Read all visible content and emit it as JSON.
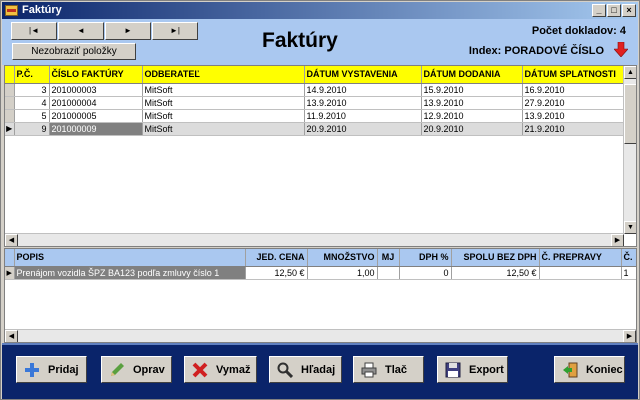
{
  "window": {
    "title": "Faktúry"
  },
  "titlebar_buttons": [
    "_",
    "□",
    "×"
  ],
  "header": {
    "nav_buttons": [
      "|◄",
      "◄",
      "►",
      "►|"
    ],
    "hide_button": "Nezobraziť položky",
    "title": "Faktúry",
    "doc_count": "Počet dokladov: 4",
    "index_label": "Index: PORADOVÉ ČÍSLO",
    "sort_arrow_color": "#e02020"
  },
  "invoices": {
    "columns": [
      "P.Č.",
      "ČÍSLO FAKTÚRY",
      "ODBERATEĽ",
      "DÁTUM VYSTAVENIA",
      "DÁTUM DODANIA",
      "DÁTUM SPLATNOSTI"
    ],
    "rows": [
      {
        "pc": "3",
        "cislo": "201000003",
        "odberatel": "MitSoft",
        "vystavenia": "14.9.2010",
        "dodania": "15.9.2010",
        "splatnosti": "16.9.2010"
      },
      {
        "pc": "4",
        "cislo": "201000004",
        "odberatel": "MitSoft",
        "vystavenia": "13.9.2010",
        "dodania": "13.9.2010",
        "splatnosti": "27.9.2010"
      },
      {
        "pc": "5",
        "cislo": "201000005",
        "odberatel": "MitSoft",
        "vystavenia": "11.9.2010",
        "dodania": "12.9.2010",
        "splatnosti": "13.9.2010"
      },
      {
        "pc": "9",
        "cislo": "201000009",
        "odberatel": "MitSoft",
        "vystavenia": "20.9.2010",
        "dodania": "20.9.2010",
        "splatnosti": "21.9.2010"
      }
    ],
    "active_row": 3
  },
  "items": {
    "columns": [
      "POPIS",
      "JED. CENA",
      "MNOŽSTVO",
      "MJ",
      "DPH %",
      "SPOLU BEZ DPH",
      "Č. PREPRAVY",
      "Č."
    ],
    "rows": [
      {
        "popis": "Prenájom vozidla ŠPZ BA123 podľa zmluvy číslo 1",
        "cena": "12,50 €",
        "mnozstvo": "1,00",
        "mj": "",
        "dph": "0",
        "spolu": "12,50 €",
        "preprava": "",
        "c": "1"
      }
    ]
  },
  "actions": {
    "add": "Pridaj",
    "edit": "Oprav",
    "delete": "Vymaž",
    "search": "Hľadaj",
    "print": "Tlač",
    "export": "Export",
    "exit": "Koniec"
  },
  "icons": {
    "add": "plus-icon",
    "edit": "pencil-icon",
    "delete": "x-icon",
    "search": "magnifier-icon",
    "print": "printer-icon",
    "export": "save-icon",
    "exit": "exit-icon"
  }
}
